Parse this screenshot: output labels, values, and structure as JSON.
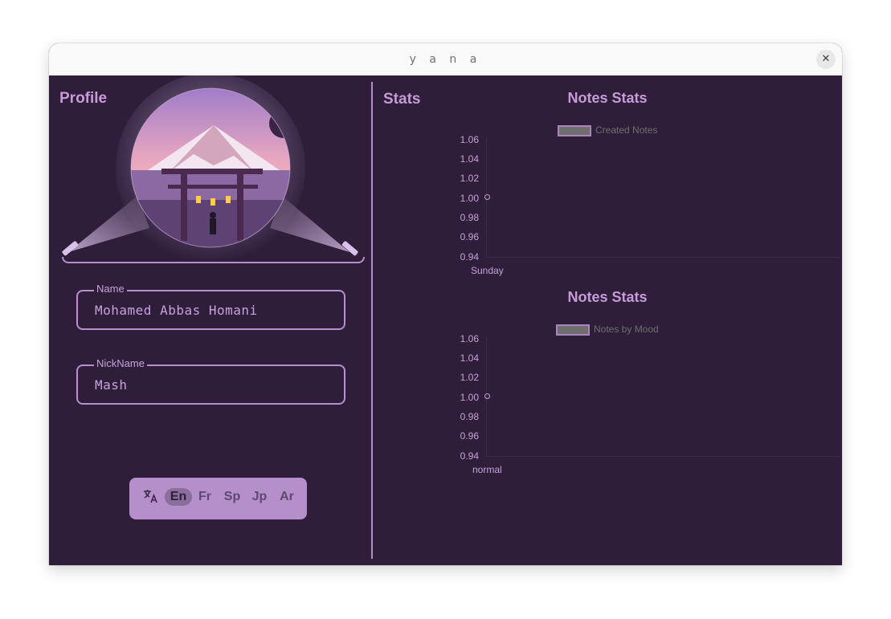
{
  "window": {
    "title": "y a n a",
    "close_label": "✕"
  },
  "profile": {
    "title": "Profile",
    "name_label": "Name",
    "name_value": "Mohamed Abbas Homani",
    "nickname_label": "NickName",
    "nickname_value": "Mash"
  },
  "language": {
    "icon": "translate-icon",
    "options": [
      "En",
      "Fr",
      "Sp",
      "Jp",
      "Ar"
    ],
    "selected": "En"
  },
  "stats": {
    "title": "Stats",
    "charts": [
      {
        "title": "Notes Stats",
        "legend": "Created Notes"
      },
      {
        "title": "Notes Stats",
        "legend": "Notes by Mood"
      }
    ]
  },
  "chart_data": [
    {
      "type": "line",
      "title": "Notes Stats",
      "series": [
        {
          "name": "Created Notes",
          "values": [
            1.0
          ]
        }
      ],
      "categories": [
        "Sunday"
      ],
      "yticks": [
        "1.06",
        "1.04",
        "1.02",
        "1.00",
        "0.98",
        "0.96",
        "0.94"
      ],
      "ylim": [
        0.94,
        1.06
      ]
    },
    {
      "type": "line",
      "title": "Notes Stats",
      "series": [
        {
          "name": "Notes by Mood",
          "values": [
            1.0
          ]
        }
      ],
      "categories": [
        "normal"
      ],
      "yticks": [
        "1.06",
        "1.04",
        "1.02",
        "1.00",
        "0.98",
        "0.96",
        "0.94"
      ],
      "ylim": [
        0.94,
        1.06
      ]
    }
  ],
  "colors": {
    "background": "#2e1e3a",
    "accent": "#c79bd8",
    "language_bar": "#b48fc9"
  }
}
